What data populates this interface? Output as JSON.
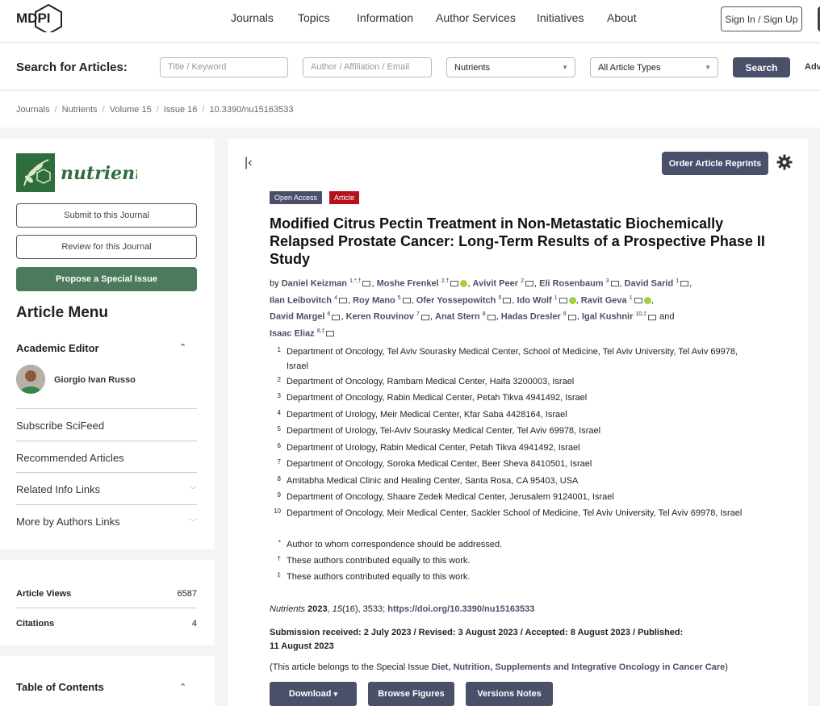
{
  "header": {
    "logo_text": "MDPI",
    "nav": [
      "Journals",
      "Topics",
      "Information",
      "Author Services",
      "Initiatives",
      "About"
    ],
    "signin_label": "Sign In / Sign Up"
  },
  "search": {
    "title": "Search for Articles:",
    "keyword_placeholder": "Title / Keyword",
    "author_placeholder": "Author / Affiliation / Email",
    "journal_value": "Nutrients",
    "type_value": "All Article Types",
    "button_label": "Search",
    "advanced_label": "Adv"
  },
  "breadcrumb": [
    "Journals",
    "Nutrients",
    "Volume 15",
    "Issue 16",
    "10.3390/nu15163533"
  ],
  "sidebar": {
    "journal_name": "nutrients",
    "submit_label": "Submit to this Journal",
    "review_label": "Review for this Journal",
    "propose_label": "Propose a Special Issue",
    "menu_title": "Article Menu",
    "academic_editor_label": "Academic Editor",
    "editor_name": "Giorgio Ivan Russo",
    "links": [
      "Subscribe SciFeed",
      "Recommended Articles",
      "Related Info Links",
      "More by Authors Links"
    ],
    "views_label": "Article Views",
    "views_value": "6587",
    "citations_label": "Citations",
    "citations_value": "4",
    "toc_label": "Table of Contents"
  },
  "article": {
    "reprint_label": "Order Article Reprints",
    "badge_open": "Open Access",
    "badge_type": "Article",
    "title": "Modified Citrus Pectin Treatment in Non-Metastatic Biochemically Relapsed Prostate Cancer: Long-Term Results of a Prospective Phase II Study",
    "by": "by",
    "and": "and",
    "authors": [
      {
        "name": "Daniel Keizman",
        "sup": "1,*,†"
      },
      {
        "name": "Moshe Frenkel",
        "sup": "2,†"
      },
      {
        "name": "Avivit Peer",
        "sup": "2"
      },
      {
        "name": "Eli Rosenbaum",
        "sup": "3"
      },
      {
        "name": "David Sarid",
        "sup": "1"
      },
      {
        "name": "Ilan Leibovitch",
        "sup": "4"
      },
      {
        "name": "Roy Mano",
        "sup": "5"
      },
      {
        "name": "Ofer Yossepowitch",
        "sup": "5"
      },
      {
        "name": "Ido Wolf",
        "sup": "1"
      },
      {
        "name": "Ravit Geva",
        "sup": "1"
      },
      {
        "name": "David Margel",
        "sup": "6"
      },
      {
        "name": "Keren Rouvinov",
        "sup": "7"
      },
      {
        "name": "Anat Stern",
        "sup": "8"
      },
      {
        "name": "Hadas Dresler",
        "sup": "9"
      },
      {
        "name": "Igal Kushnir",
        "sup": "10,‡"
      },
      {
        "name": "Isaac Eliaz",
        "sup": "8,‡"
      }
    ],
    "affiliations": [
      {
        "num": "1",
        "text": "Department of Oncology, Tel Aviv Sourasky Medical Center, School of Medicine, Tel Aviv University, Tel Aviv 69978, Israel"
      },
      {
        "num": "2",
        "text": "Department of Oncology, Rambam Medical Center, Haifa 3200003, Israel"
      },
      {
        "num": "3",
        "text": "Department of Oncology, Rabin Medical Center, Petah Tikva 4941492, Israel"
      },
      {
        "num": "4",
        "text": "Department of Urology, Meir Medical Center, Kfar Saba 4428164, Israel"
      },
      {
        "num": "5",
        "text": "Department of Urology, Tel-Aviv Sourasky Medical Center, Tel Aviv 69978, Israel"
      },
      {
        "num": "6",
        "text": "Department of Urology, Rabin Medical Center, Petah Tikva 4941492, Israel"
      },
      {
        "num": "7",
        "text": "Department of Oncology, Soroka Medical Center, Beer Sheva 8410501, Israel"
      },
      {
        "num": "8",
        "text": "Amitabha Medical Clinic and Healing Center, Santa Rosa, CA 95403, USA"
      },
      {
        "num": "9",
        "text": "Department of Oncology, Shaare Zedek Medical Center, Jerusalem 9124001, Israel"
      },
      {
        "num": "10",
        "text": "Department of Oncology, Meir Medical Center, Sackler School of Medicine, Tel Aviv University, Tel Aviv 69978, Israel"
      },
      {
        "num": "*",
        "text": "Author to whom correspondence should be addressed."
      },
      {
        "num": "†",
        "text": "These authors contributed equally to this work."
      },
      {
        "num": "‡",
        "text": "These authors contributed equally to this work."
      }
    ],
    "citation_journal": "Nutrients",
    "citation_year": "2023",
    "citation_volume": "15",
    "citation_rest": "(16), 3533;",
    "doi": "https://doi.org/10.3390/nu15163533",
    "dates": "Submission received: 2 July 2023 / Revised: 3 August 2023 / Accepted: 8 August 2023 / Published: 11 August 2023",
    "special_prefix": "(This article belongs to the Special Issue",
    "special_issue": "Diet, Nutrition, Supplements and Integrative Oncology in Cancer Care",
    "special_suffix": ")",
    "buttons": {
      "download": "Download",
      "figures": "Browse Figures",
      "versions": "Versions Notes"
    }
  },
  "colors": {
    "primary": "#4a4f6a",
    "journal_green": "#4b7a5c",
    "badge_red": "#b5121b",
    "orcid": "#a6ce39"
  }
}
